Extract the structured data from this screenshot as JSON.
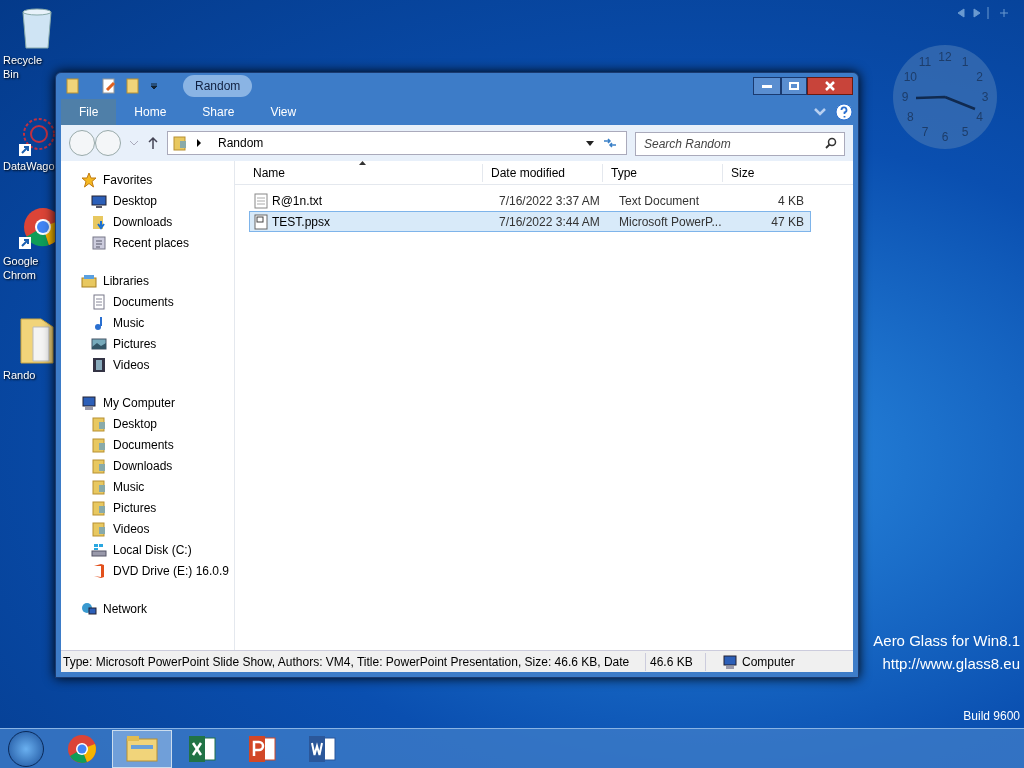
{
  "desktop_icons": [
    {
      "label": "Recycle Bin"
    },
    {
      "label": "DataWago"
    },
    {
      "label": "Google Chrom"
    },
    {
      "label": "Rando"
    }
  ],
  "clock": {
    "numerals": [
      "11",
      "12",
      "1",
      "10",
      "2",
      "9",
      "3",
      "8",
      "4",
      "7",
      "6",
      "5"
    ]
  },
  "overlay": {
    "line1": "Aero Glass for Win8.1",
    "line2": "http://www.glass8.eu",
    "build": "Build 9600"
  },
  "window": {
    "title": "Random",
    "ribbon_tabs": [
      {
        "label": "File",
        "selected": true
      },
      {
        "label": "Home",
        "selected": false
      },
      {
        "label": "Share",
        "selected": false
      },
      {
        "label": "View",
        "selected": false
      }
    ],
    "address": {
      "crumb": "Random"
    },
    "search": {
      "placeholder": "Search Random"
    },
    "sidebar": [
      {
        "label": "Favorites",
        "children": [
          {
            "label": "Desktop"
          },
          {
            "label": "Downloads"
          },
          {
            "label": "Recent places"
          }
        ]
      },
      {
        "label": "Libraries",
        "children": [
          {
            "label": "Documents"
          },
          {
            "label": "Music"
          },
          {
            "label": "Pictures"
          },
          {
            "label": "Videos"
          }
        ]
      },
      {
        "label": "My Computer",
        "children": [
          {
            "label": "Desktop"
          },
          {
            "label": "Documents"
          },
          {
            "label": "Downloads"
          },
          {
            "label": "Music"
          },
          {
            "label": "Pictures"
          },
          {
            "label": "Videos"
          },
          {
            "label": "Local Disk (C:)"
          },
          {
            "label": "DVD Drive (E:) 16.0.9"
          }
        ]
      },
      {
        "label": "Network"
      }
    ],
    "columns": [
      "Name",
      "Date modified",
      "Type",
      "Size"
    ],
    "rows": [
      {
        "name": "R@1n.txt",
        "kind": "text",
        "date": "7/16/2022 3:37 AM",
        "type": "Text Document",
        "size": "4 KB",
        "selected": false
      },
      {
        "name": "TEST.ppsx",
        "kind": "slides",
        "date": "7/16/2022 3:44 AM",
        "type": "Microsoft PowerP...",
        "size": "47 KB",
        "selected": true
      }
    ],
    "status": {
      "details": "Type: Microsoft PowerPoint Slide Show, Authors: VM4, Title: PowerPoint Presentation, Size: 46.6 KB, Date",
      "size": "46.6 KB",
      "location": "Computer"
    }
  },
  "taskbar": [
    {
      "active": false
    },
    {
      "active": true
    },
    {
      "active": false
    },
    {
      "active": false
    },
    {
      "active": false
    }
  ]
}
